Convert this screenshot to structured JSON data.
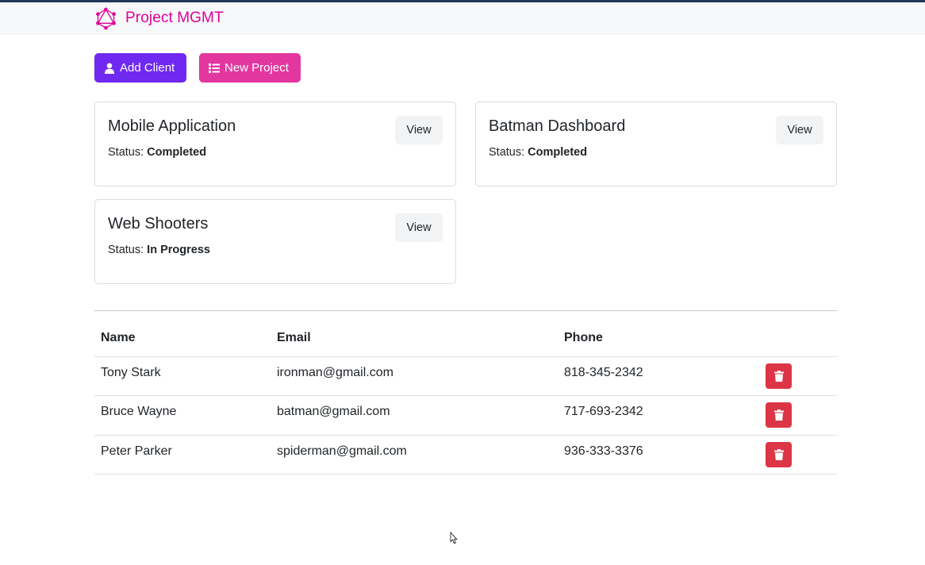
{
  "navbar": {
    "brand_name": "Project MGMT",
    "logo_icon": "graphql-logo-icon",
    "brand_color": "#e10098"
  },
  "actions": {
    "add_client_label": "Add Client",
    "add_client_icon": "user-icon",
    "new_project_label": "New Project",
    "new_project_icon": "list-icon"
  },
  "projects": [
    {
      "name": "Mobile Application",
      "status_label": "Status:",
      "status": "Completed",
      "view_label": "View"
    },
    {
      "name": "Batman Dashboard",
      "status_label": "Status:",
      "status": "Completed",
      "view_label": "View"
    },
    {
      "name": "Web Shooters",
      "status_label": "Status:",
      "status": "In Progress",
      "view_label": "View"
    }
  ],
  "clients_table": {
    "headers": [
      "Name",
      "Email",
      "Phone",
      ""
    ],
    "rows": [
      {
        "name": "Tony Stark",
        "email": "ironman@gmail.com",
        "phone": "818-345-2342",
        "delete_icon": "trash-icon"
      },
      {
        "name": "Bruce Wayne",
        "email": "batman@gmail.com",
        "phone": "717-693-2342",
        "delete_icon": "trash-icon"
      },
      {
        "name": "Peter Parker",
        "email": "spiderman@gmail.com",
        "phone": "936-333-3376",
        "delete_icon": "trash-icon"
      }
    ]
  },
  "colors": {
    "add_client_button": "#7029f0",
    "new_project_button": "#e3369f",
    "delete_button": "#dc3545",
    "top_border": "#1f3a5c"
  }
}
